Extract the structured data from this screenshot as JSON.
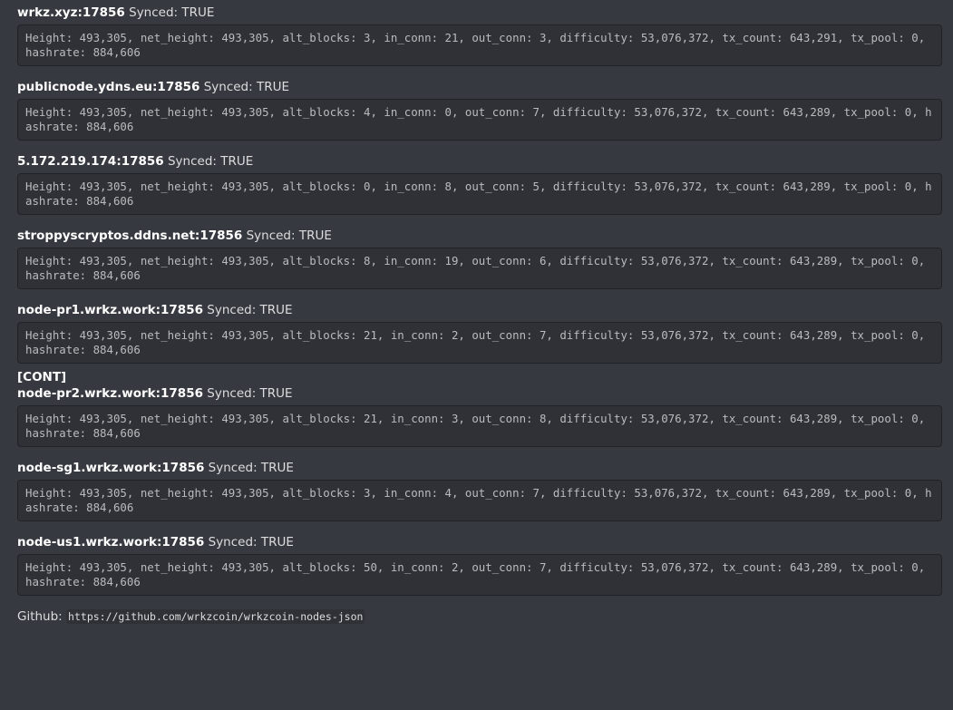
{
  "nodes": [
    {
      "host": "wrkz.xyz:17856",
      "synced": "Synced: TRUE",
      "info": "Height: 493,305, net_height: 493,305, alt_blocks: 3, in_conn: 21, out_conn: 3, difficulty: 53,076,372, tx_count: 643,291, tx_pool: 0, hashrate: 884,606"
    },
    {
      "host": "publicnode.ydns.eu:17856",
      "synced": "Synced: TRUE",
      "info": "Height: 493,305, net_height: 493,305, alt_blocks: 4, in_conn: 0, out_conn: 7, difficulty: 53,076,372, tx_count: 643,289, tx_pool: 0, hashrate: 884,606"
    },
    {
      "host": "5.172.219.174:17856",
      "synced": "Synced: TRUE",
      "info": "Height: 493,305, net_height: 493,305, alt_blocks: 0, in_conn: 8, out_conn: 5, difficulty: 53,076,372, tx_count: 643,289, tx_pool: 0, hashrate: 884,606"
    },
    {
      "host": "stroppyscryptos.ddns.net:17856",
      "synced": "Synced: TRUE",
      "info": "Height: 493,305, net_height: 493,305, alt_blocks: 8, in_conn: 19, out_conn: 6, difficulty: 53,076,372, tx_count: 643,289, tx_pool: 0, hashrate: 884,606"
    },
    {
      "host": "node-pr1.wrkz.work:17856",
      "synced": "Synced: TRUE",
      "info": "Height: 493,305, net_height: 493,305, alt_blocks: 21, in_conn: 2, out_conn: 7, difficulty: 53,076,372, tx_count: 643,289, tx_pool: 0, hashrate: 884,606"
    },
    {
      "host": "node-pr2.wrkz.work:17856",
      "synced": "Synced: TRUE",
      "info": "Height: 493,305, net_height: 493,305, alt_blocks: 21, in_conn: 3, out_conn: 8, difficulty: 53,076,372, tx_count: 643,289, tx_pool: 0, hashrate: 884,606"
    },
    {
      "host": "node-sg1.wrkz.work:17856",
      "synced": "Synced: TRUE",
      "info": "Height: 493,305, net_height: 493,305, alt_blocks: 3, in_conn: 4, out_conn: 7, difficulty: 53,076,372, tx_count: 643,289, tx_pool: 0, hashrate: 884,606"
    },
    {
      "host": "node-us1.wrkz.work:17856",
      "synced": "Synced: TRUE",
      "info": "Height: 493,305, net_height: 493,305, alt_blocks: 50, in_conn: 2, out_conn: 7, difficulty: 53,076,372, tx_count: 643,289, tx_pool: 0, hashrate: 884,606"
    }
  ],
  "cont_marker": "[CONT]",
  "footer": {
    "label": "Github:",
    "link": "https://github.com/wrkzcoin/wrkzcoin-nodes-json"
  },
  "colors": {
    "background": "#36393f",
    "code_background": "#2f3136",
    "text": "#dcddde",
    "code_text": "#b9bbbe"
  }
}
